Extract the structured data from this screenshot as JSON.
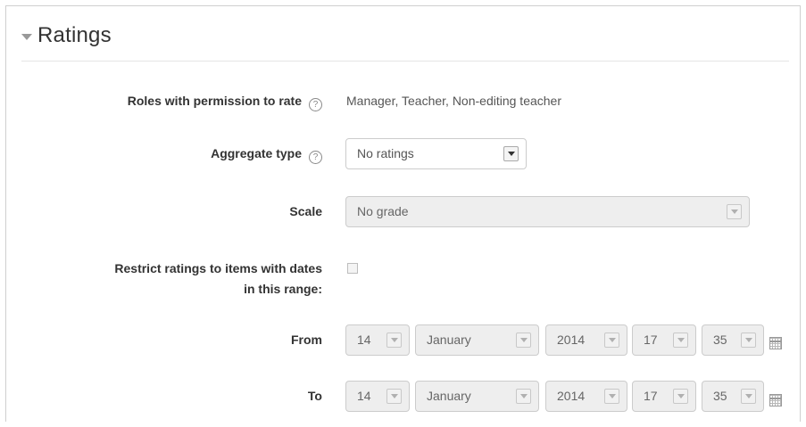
{
  "section": {
    "title": "Ratings"
  },
  "fields": {
    "roles": {
      "label": "Roles with permission to rate",
      "value": "Manager, Teacher, Non-editing teacher"
    },
    "aggregate": {
      "label": "Aggregate type",
      "selected": "No ratings"
    },
    "scale": {
      "label": "Scale",
      "selected": "No grade"
    },
    "restrict": {
      "label_line1": "Restrict ratings to items with dates",
      "label_line2": "in this range:",
      "checked": false
    },
    "from": {
      "label": "From",
      "day": "14",
      "month": "January",
      "year": "2014",
      "hour": "17",
      "minute": "35"
    },
    "to": {
      "label": "To",
      "day": "14",
      "month": "January",
      "year": "2014",
      "hour": "17",
      "minute": "35"
    }
  },
  "icons": {
    "help": "help-circle-icon",
    "collapse": "caret-down-icon",
    "calendar": "calendar-icon"
  },
  "help_glyph": "?"
}
